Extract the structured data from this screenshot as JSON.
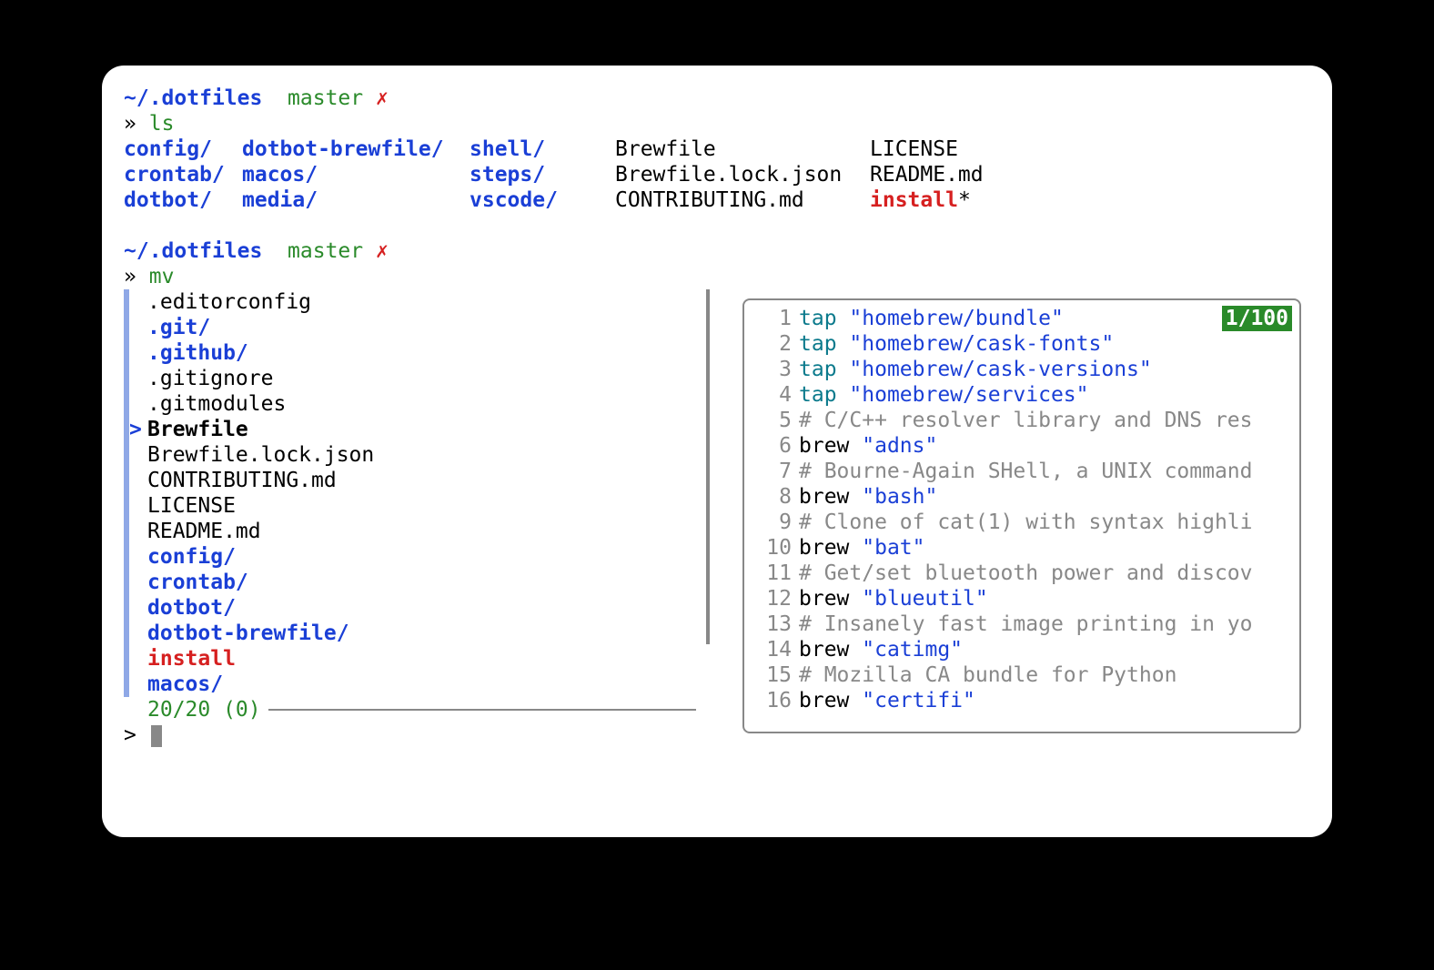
{
  "prompt1": {
    "path_prefix": "~/",
    "path_name": ".dotfiles",
    "branch": "master",
    "dirty": "✗",
    "ps_marker": "»",
    "command": "ls"
  },
  "ls": {
    "col1": [
      "config/",
      "crontab/",
      "dotbot/"
    ],
    "col2": [
      "dotbot-brewfile/",
      "macos/",
      "media/"
    ],
    "col3": [
      "shell/",
      "steps/",
      "vscode/"
    ],
    "col4": [
      "Brewfile",
      "Brewfile.lock.json",
      "CONTRIBUTING.md"
    ],
    "col5": [
      "LICENSE",
      "README.md",
      "install",
      "*"
    ]
  },
  "prompt2": {
    "path_prefix": "~/",
    "path_name": ".dotfiles",
    "branch": "master",
    "dirty": "✗",
    "ps_marker": "»",
    "command": "mv"
  },
  "fzf": {
    "items": [
      {
        "label": ".editorconfig",
        "type": "file"
      },
      {
        "label": ".git/",
        "type": "dir"
      },
      {
        "label": ".github/",
        "type": "dir"
      },
      {
        "label": ".gitignore",
        "type": "file"
      },
      {
        "label": ".gitmodules",
        "type": "file"
      },
      {
        "label": "Brewfile",
        "type": "file",
        "selected": true
      },
      {
        "label": "Brewfile.lock.json",
        "type": "file"
      },
      {
        "label": "CONTRIBUTING.md",
        "type": "file"
      },
      {
        "label": "LICENSE",
        "type": "file"
      },
      {
        "label": "README.md",
        "type": "file"
      },
      {
        "label": "config/",
        "type": "dir"
      },
      {
        "label": "crontab/",
        "type": "dir"
      },
      {
        "label": "dotbot/",
        "type": "dir"
      },
      {
        "label": "dotbot-brewfile/",
        "type": "dir"
      },
      {
        "label": "install",
        "type": "exec"
      },
      {
        "label": "macos/",
        "type": "dir"
      }
    ],
    "status": "20/20 (0)",
    "pointer": ">",
    "prompt_marker": ">",
    "query": ""
  },
  "preview": {
    "badge": "1/100",
    "lines": [
      {
        "n": 1,
        "kind": "tap",
        "cmd": "tap",
        "arg": "\"homebrew/bundle\""
      },
      {
        "n": 2,
        "kind": "tap",
        "cmd": "tap",
        "arg": "\"homebrew/cask-fonts\""
      },
      {
        "n": 3,
        "kind": "tap",
        "cmd": "tap",
        "arg": "\"homebrew/cask-versions\""
      },
      {
        "n": 4,
        "kind": "tap",
        "cmd": "tap",
        "arg": "\"homebrew/services\""
      },
      {
        "n": 5,
        "kind": "comment",
        "text": "# C/C++ resolver library and DNS res"
      },
      {
        "n": 6,
        "kind": "brew",
        "cmd": "brew",
        "arg": "\"adns\""
      },
      {
        "n": 7,
        "kind": "comment",
        "text": "# Bourne-Again SHell, a UNIX command"
      },
      {
        "n": 8,
        "kind": "brew",
        "cmd": "brew",
        "arg": "\"bash\""
      },
      {
        "n": 9,
        "kind": "comment",
        "text": "# Clone of cat(1) with syntax highli"
      },
      {
        "n": 10,
        "kind": "brew",
        "cmd": "brew",
        "arg": "\"bat\""
      },
      {
        "n": 11,
        "kind": "comment",
        "text": "# Get/set bluetooth power and discov"
      },
      {
        "n": 12,
        "kind": "brew",
        "cmd": "brew",
        "arg": "\"blueutil\""
      },
      {
        "n": 13,
        "kind": "comment",
        "text": "# Insanely fast image printing in yo"
      },
      {
        "n": 14,
        "kind": "brew",
        "cmd": "brew",
        "arg": "\"catimg\""
      },
      {
        "n": 15,
        "kind": "comment",
        "text": "# Mozilla CA bundle for Python"
      },
      {
        "n": 16,
        "kind": "brew",
        "cmd": "brew",
        "arg": "\"certifi\""
      }
    ]
  }
}
